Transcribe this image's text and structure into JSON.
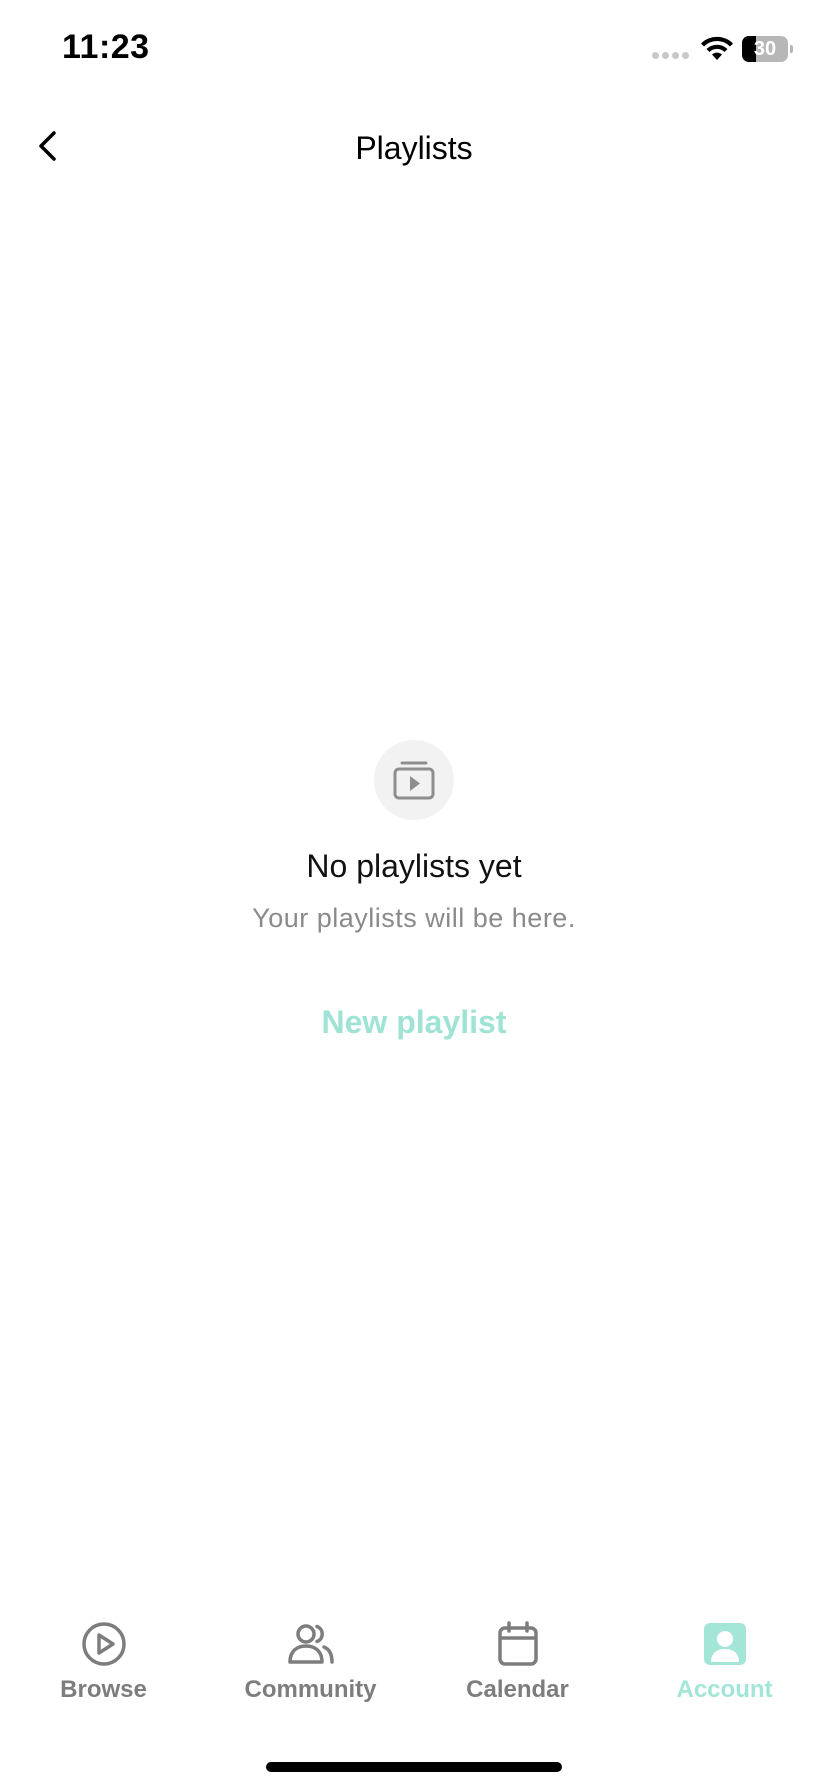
{
  "status_bar": {
    "time": "11:23",
    "battery_level": "30",
    "battery_fraction": 0.3
  },
  "nav": {
    "title": "Playlists"
  },
  "empty_state": {
    "title": "No playlists yet",
    "subtitle": "Your playlists will be here.",
    "action_label": "New playlist",
    "icon": "playlist-play-icon"
  },
  "tabs": [
    {
      "label": "Browse",
      "icon": "play-circle-icon",
      "active": false
    },
    {
      "label": "Community",
      "icon": "users-icon",
      "active": false
    },
    {
      "label": "Calendar",
      "icon": "calendar-icon",
      "active": false
    },
    {
      "label": "Account",
      "icon": "account-icon",
      "active": true
    }
  ],
  "colors": {
    "accent": "#9fe3d5",
    "tab_inactive": "#7d7d7d",
    "subtitle": "#8a8a8a"
  }
}
